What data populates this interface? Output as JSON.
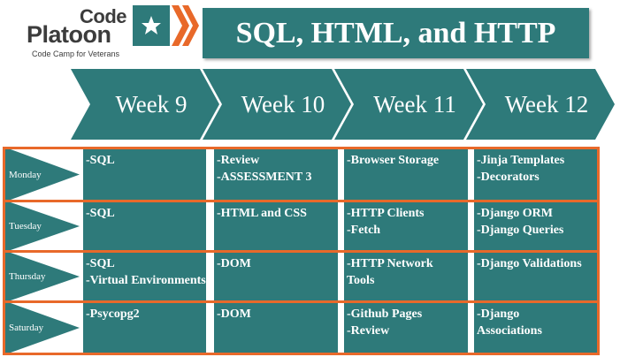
{
  "logo": {
    "word1": "Code",
    "word2": "Platoon",
    "tagline": "Code Camp for Veterans",
    "star_icon": "star-icon",
    "colors": {
      "text": "#3c3c3c",
      "teal": "#2e7a7a",
      "orange": "#e8692a"
    }
  },
  "title": "SQL, HTML, and HTTP",
  "weeks": [
    "Week 9",
    "Week 10",
    "Week 11",
    "Week 12"
  ],
  "days": [
    "Monday",
    "Tuesday",
    "Thursday",
    "Saturday"
  ],
  "schedule": [
    [
      [
        "-SQL"
      ],
      [
        "-Review",
        "-ASSESSMENT 3"
      ],
      [
        "-Browser Storage"
      ],
      [
        "-Jinja Templates",
        "-Decorators"
      ]
    ],
    [
      [
        "-SQL"
      ],
      [
        "-HTML and CSS"
      ],
      [
        "-HTTP Clients",
        "-Fetch"
      ],
      [
        "-Django ORM",
        "-Django Queries"
      ]
    ],
    [
      [
        "-SQL",
        "-Virtual Environments"
      ],
      [
        "-DOM"
      ],
      [
        "-HTTP Network",
        "Tools"
      ],
      [
        "-Django Validations"
      ]
    ],
    [
      [
        "-Psycopg2"
      ],
      [
        "-DOM"
      ],
      [
        "-Github Pages",
        "-Review"
      ],
      [
        "-Django",
        "Associations"
      ]
    ]
  ],
  "colors": {
    "teal": "#2e7a7a",
    "border": "#e8692a",
    "text": "#ffffff"
  }
}
